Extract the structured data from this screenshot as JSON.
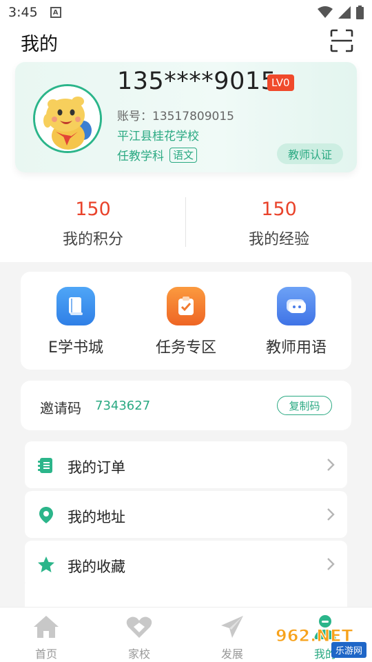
{
  "status_bar": {
    "time": "3:45",
    "notification_letter": "A"
  },
  "header": {
    "title": "我的"
  },
  "profile": {
    "phone": "135****9015",
    "level": "LV0",
    "account_label": "账号：13517809015",
    "school": "平江县桂花学校",
    "subject_label": "任教学科",
    "subject_tag": "语文",
    "verify_button": "教师认证"
  },
  "stats": [
    {
      "value": "150",
      "label": "我的积分"
    },
    {
      "value": "150",
      "label": "我的经验"
    }
  ],
  "shortcuts": [
    {
      "label": "E学书城",
      "icon": "book-icon",
      "color": "#3b8ff0"
    },
    {
      "label": "任务专区",
      "icon": "clipboard-check-icon",
      "color": "#f47a2e"
    },
    {
      "label": "教师用语",
      "icon": "chat-bubble-icon",
      "color": "#4e86f2"
    }
  ],
  "invite": {
    "label": "邀请码",
    "code": "7343627",
    "copy_button": "复制码"
  },
  "menu": [
    {
      "label": "我的订单",
      "icon": "order-list-icon"
    },
    {
      "label": "我的地址",
      "icon": "location-pin-icon"
    },
    {
      "label": "我的收藏",
      "icon": "star-icon"
    }
  ],
  "bottom_nav": [
    {
      "label": "首页",
      "icon": "home-icon"
    },
    {
      "label": "家校",
      "icon": "heart-hands-icon"
    },
    {
      "label": "发展",
      "icon": "paper-plane-icon"
    },
    {
      "label": "我的",
      "icon": "profile-icon"
    }
  ],
  "watermark": {
    "logo": "962.NET",
    "text": "乐游网"
  },
  "colors": {
    "accent": "#2aa982",
    "stat_value": "#e9432b",
    "level_badge": "#f04a2b"
  }
}
